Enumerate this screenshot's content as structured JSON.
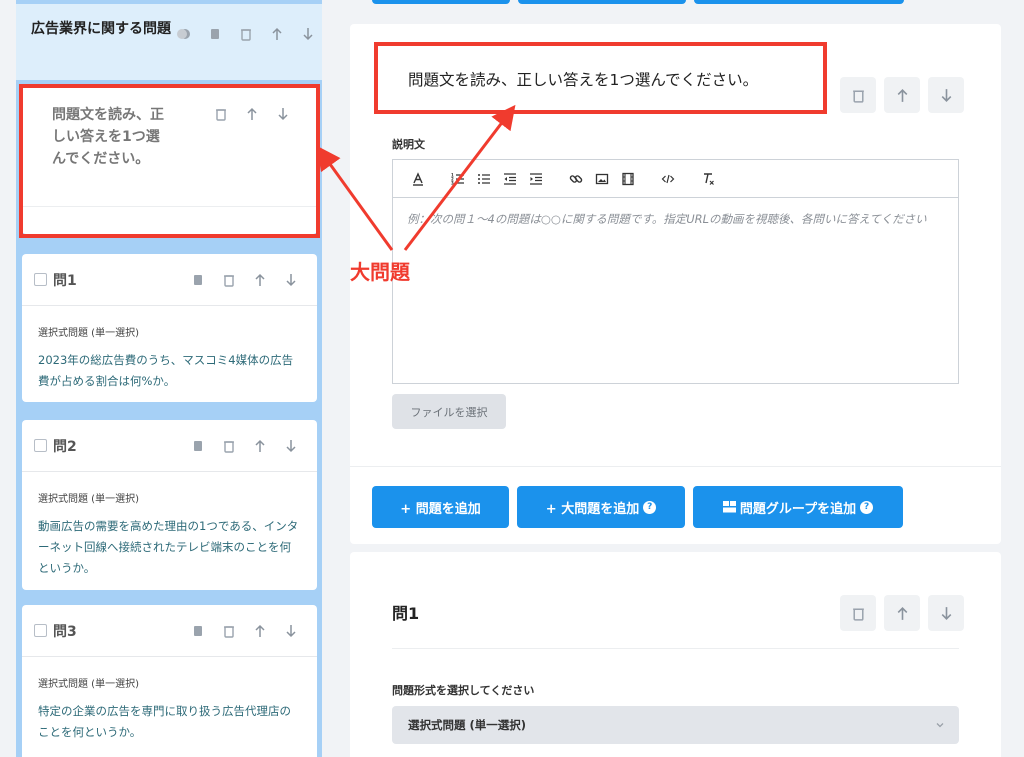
{
  "sidebar": {
    "title": "広告業界に関する問題",
    "big_question": {
      "text": "問題文を読み、正しい答えを1つ選んでください。"
    },
    "questions": [
      {
        "label": "問1",
        "type": "選択式問題 (単一選択)",
        "text": "2023年の総広告費のうち、マスコミ4媒体の広告費が占める割合は何%か。"
      },
      {
        "label": "問2",
        "type": "選択式問題 (単一選択)",
        "text": "動画広告の需要を高めた理由の1つである、インターネット回線へ接続されたテレビ端末のことを何というか。"
      },
      {
        "label": "問3",
        "type": "選択式問題 (単一選択)",
        "text": "特定の企業の広告を専門に取り扱う広告代理店のことを何というか。"
      }
    ]
  },
  "main": {
    "big_question_title": "問題文を読み、正しい答えを1つ選んでください。",
    "description_label": "説明文",
    "editor_placeholder": "例：次の問１〜4の問題は○○に関する問題です。指定URLの動画を視聴後、各問いに答えてください",
    "file_button": "ファイルを選択",
    "add_buttons": {
      "add_question": "+ 問題を追加",
      "add_big_question": "+ 大問題を追加",
      "add_group": "問題グループを追加"
    },
    "question1": {
      "title": "問1",
      "format_label": "問題形式を選択してください",
      "format_value": "選択式問題 (単一選択)"
    }
  },
  "annotation": {
    "label": "大問題",
    "color": "#f03b2e"
  },
  "colors": {
    "accent": "#1b92ec",
    "sidebar": "#a6d0f6"
  }
}
